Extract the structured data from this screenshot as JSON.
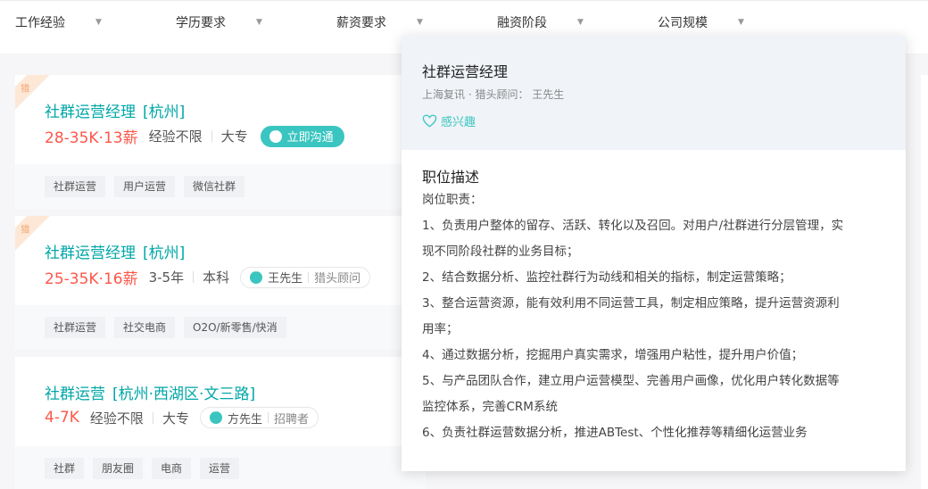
{
  "filters": [
    {
      "label": "工作经验"
    },
    {
      "label": "学历要求"
    },
    {
      "label": "薪资要求"
    },
    {
      "label": "融资阶段"
    },
    {
      "label": "公司规模"
    }
  ],
  "jobs": [
    {
      "ribbon": "猎",
      "title": "社群运营经理",
      "city": "[杭州]",
      "salary": "28-35K·13薪",
      "experience": "经验不限",
      "education": "大专",
      "action_label": "立即沟通",
      "recruiter_name": "",
      "recruiter_role": "",
      "tags": [
        "社群运营",
        "用户运营",
        "微信社群"
      ]
    },
    {
      "ribbon": "猎",
      "title": "社群运营经理",
      "city": "[杭州]",
      "salary": "25-35K·16薪",
      "experience": "3-5年",
      "education": "本科",
      "recruiter_name": "王先生",
      "recruiter_role": "猎头顾问",
      "tags": [
        "社群运营",
        "社交电商",
        "O2O/新零售/快消"
      ]
    },
    {
      "title": "社群运营",
      "city": "[杭州·西湖区·文三路]",
      "salary": "4-7K",
      "experience": "经验不限",
      "education": "大专",
      "recruiter_name": "方先生",
      "recruiter_role": "招聘者",
      "tags": [
        "社群",
        "朋友圈",
        "电商",
        "运营"
      ]
    }
  ],
  "popup": {
    "title": "社群运营经理",
    "company_line": "上海复讯 · 猎头顾问：  王先生",
    "interest_label": "感兴趣",
    "desc_title": "职位描述",
    "desc_lines": [
      "岗位职责：",
      "1、负责用户整体的留存、活跃、转化以及召回。对用户/社群进行分层管理，实",
      "现不同阶段社群的业务目标；",
      "2、结合数据分析、监控社群行为动线和相关的指标，制定运营策略；",
      "3、整合运营资源，能有效利用不同运营工具，制定相应策略，提升运营资源利",
      "用率；",
      "4、通过数据分析，挖掘用户真实需求，增强用户粘性，提升用户价值；",
      "5、与产品团队合作，建立用户运营模型、完善用户画像，优化用户转化数据等",
      "监控体系，完善CRM系统",
      "6、负责社群运营数据分析，推进ABTest、个性化推荐等精细化运营业务"
    ]
  },
  "colors": {
    "accent": "#00a6a7",
    "salary": "#fe574a",
    "chat": "#3ac5c0"
  }
}
